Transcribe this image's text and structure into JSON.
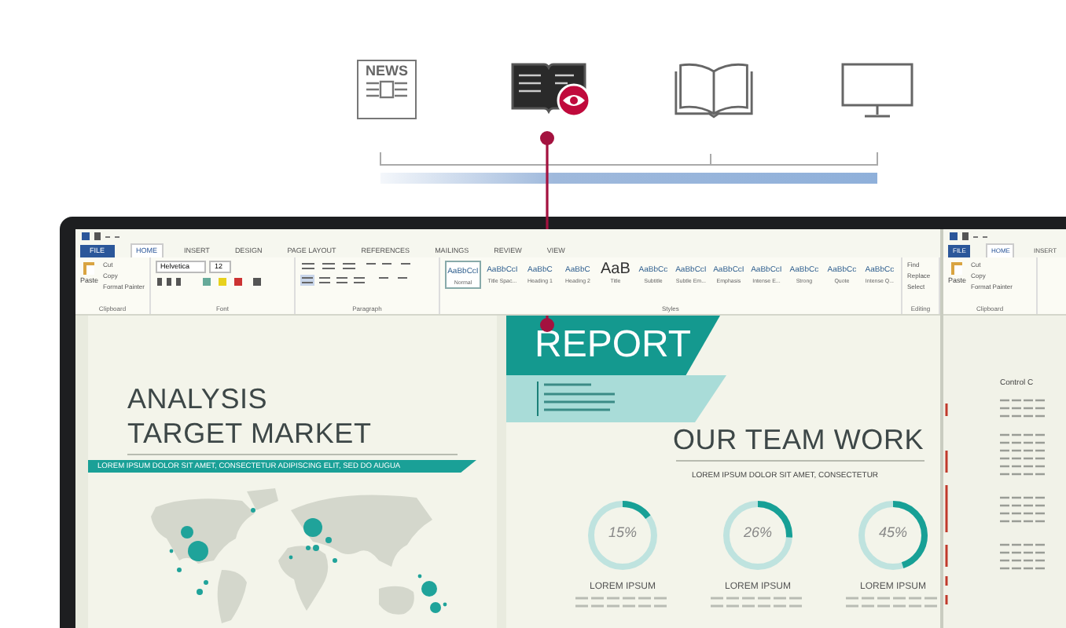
{
  "media_timeline": {
    "items": [
      {
        "kind": "newspaper",
        "label": "NEWS",
        "selected": false
      },
      {
        "kind": "ebook",
        "selected": true
      },
      {
        "kind": "book",
        "selected": false
      },
      {
        "kind": "monitor",
        "selected": false
      }
    ]
  },
  "word_window": {
    "file_button": "FILE",
    "tabs": [
      {
        "label": "HOME",
        "selected": true
      },
      {
        "label": "INSERT",
        "selected": false
      },
      {
        "label": "DESIGN",
        "selected": false
      },
      {
        "label": "PAGE LAYOUT",
        "selected": false
      },
      {
        "label": "REFERENCES",
        "selected": false
      },
      {
        "label": "MAILINGS",
        "selected": false
      },
      {
        "label": "REVIEW",
        "selected": false
      },
      {
        "label": "VIEW",
        "selected": false
      }
    ],
    "paste": "Paste",
    "clipboard": [
      "Cut",
      "Copy",
      "Format Painter"
    ],
    "font_name": "Helvetica",
    "font_size": "12",
    "styles": [
      {
        "preview": "AaBbCcI",
        "name": "Normal",
        "selected": true
      },
      {
        "preview": "AaBbCcI",
        "name": "Title Spac...",
        "selected": false
      },
      {
        "preview": "AaBbC",
        "name": "Heading 1",
        "selected": false
      },
      {
        "preview": "AaBbC",
        "name": "Heading 2",
        "selected": false
      },
      {
        "preview": "AaB",
        "name": "Title",
        "selected": false
      },
      {
        "preview": "AaBbCc",
        "name": "Subtitle",
        "selected": false
      },
      {
        "preview": "AaBbCcI",
        "name": "Subtle Em...",
        "selected": false
      },
      {
        "preview": "AaBbCcI",
        "name": "Emphasis",
        "selected": false
      },
      {
        "preview": "AaBbCcI",
        "name": "Intense E...",
        "selected": false
      },
      {
        "preview": "AaBbCc",
        "name": "Strong",
        "selected": false
      },
      {
        "preview": "AaBbCc",
        "name": "Quote",
        "selected": false
      },
      {
        "preview": "AaBbCc",
        "name": "Intense Q...",
        "selected": false
      }
    ],
    "editing": [
      "Find",
      "Replace",
      "Select"
    ],
    "groups": [
      "Clipboard",
      "Font",
      "Paragraph",
      "Styles",
      "Editing"
    ]
  },
  "left_page": {
    "title_lines": [
      "ANALYSIS",
      "TARGET MARKET"
    ],
    "banner": "LOREM IPSUM DOLOR SIT AMET, CONSECTETUR ADIPISCING ELIT, SED DO AUGUA"
  },
  "right_page": {
    "report": "REPORT",
    "heading": "OUR TEAM WORK",
    "subheading": "LOREM IPSUM DOLOR SIT AMET, CONSECTETUR",
    "stats": [
      {
        "level": 0.15,
        "value": "15%",
        "label": "LOREM IPSUM"
      },
      {
        "level": 0.26,
        "value": "26%",
        "label": "LOREM IPSUM"
      },
      {
        "level": 0.45,
        "value": "45%",
        "label": "LOREM IPSUM"
      }
    ]
  },
  "second_window": {
    "file_button": "FILE",
    "tabs": [
      {
        "label": "HOME",
        "selected": true
      },
      {
        "label": "INSERT",
        "selected": false
      }
    ],
    "paste": "Paste",
    "clipboard": [
      "Cut",
      "Copy",
      "Format Painter"
    ],
    "group": "Clipboard",
    "heading": "Control C"
  }
}
